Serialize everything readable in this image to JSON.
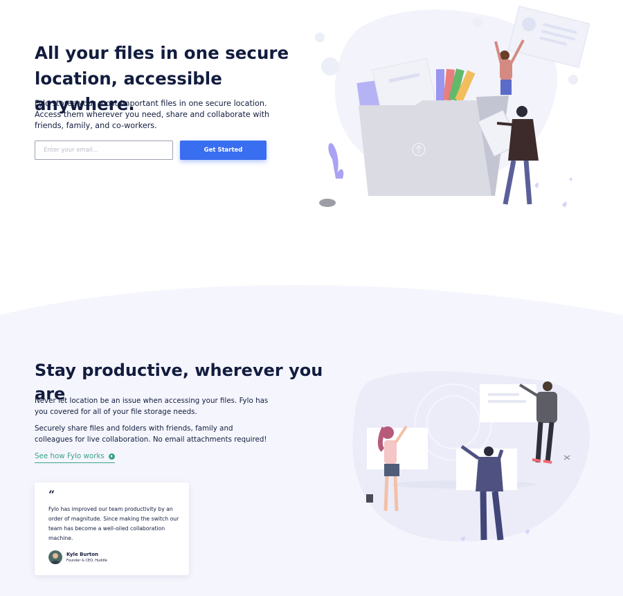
{
  "hero": {
    "title": "All your files in one secure location, accessible anywhere.",
    "description": "Fylo stores your most important files in one secure location. Access them wherever you need, share and collaborate with friends, family, and co-workers.",
    "email_placeholder": "Enter your email...",
    "cta_label": "Get Started"
  },
  "productive": {
    "title": "Stay productive, wherever you are",
    "para1": "Never let location be an issue when accessing your files. Fylo has you covered for all of your file storage needs.",
    "para2": "Securely share files and folders with friends, family and colleagues for live collaboration. No email attachments required!",
    "link_label": "See how Fylo works"
  },
  "testimonial": {
    "quote_mark": "“",
    "quote": "Fylo has improved our team productivity by an order of magnitude. Since making the switch our team has become a well-oiled collaboration machine.",
    "name": "Kyle Burton",
    "role": "Founder & CEO, Huddle"
  },
  "colors": {
    "heading": "#121c3e",
    "accent_blue": "#3a6ef0",
    "link_green": "#3ba08c",
    "section_bg": "#f5f6fd"
  },
  "icons": {
    "link_arrow": "arrow-circle-icon",
    "upload": "upload-arrow-icon"
  }
}
